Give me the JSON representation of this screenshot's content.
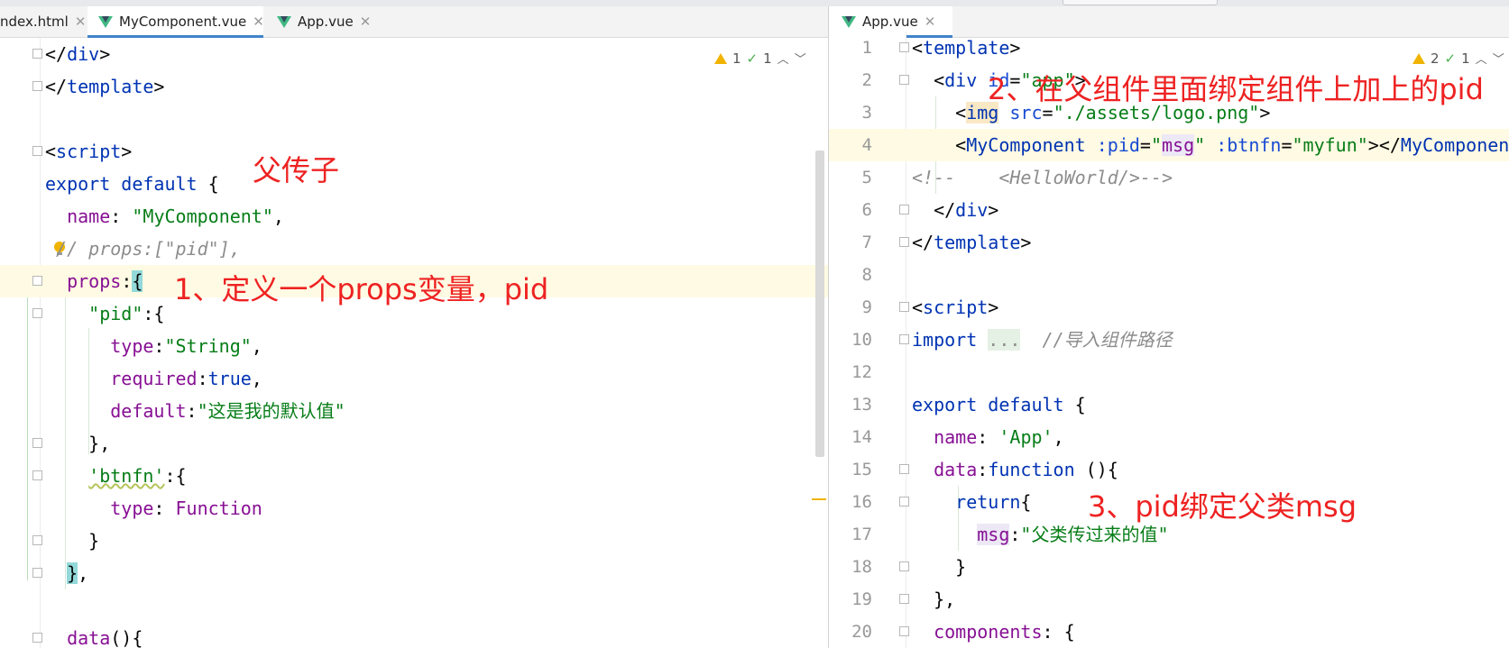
{
  "left_tabs": [
    {
      "label": "ndex.html"
    },
    {
      "label": "MyComponent.vue"
    },
    {
      "label": "App.vue"
    }
  ],
  "right_tabs": [
    {
      "label": "App.vue"
    }
  ],
  "left_indicators": {
    "warnings": "1",
    "checks": "1"
  },
  "right_indicators": {
    "warnings": "2",
    "checks": "1"
  },
  "left_code": {
    "l1": [
      "</",
      "div",
      ">"
    ],
    "l2": [
      "</",
      "template",
      ">"
    ],
    "l4": [
      "<",
      "script",
      ">"
    ],
    "l5": [
      "export default",
      " {"
    ],
    "l6": [
      "  ",
      "name",
      ": ",
      "\"MyComponent\"",
      ","
    ],
    "l7": [
      " // props:[\"pid\"],"
    ],
    "l8": [
      "  ",
      "props",
      ":",
      "{"
    ],
    "l9": [
      "    ",
      "\"pid\"",
      ":{"
    ],
    "l10": [
      "      ",
      "type",
      ":",
      "\"String\"",
      ","
    ],
    "l11": [
      "      ",
      "required",
      ":",
      "true",
      ","
    ],
    "l12": [
      "      ",
      "default",
      ":",
      "\"这是我的默认值\""
    ],
    "l13": [
      "    },"
    ],
    "l14": [
      "    ",
      "'btnfn'",
      ":{"
    ],
    "l15": [
      "      ",
      "type",
      ": ",
      "Function"
    ],
    "l16": [
      "    }"
    ],
    "l17": [
      "  ",
      "}",
      ","
    ],
    "l19": [
      "  ",
      "data",
      "(){"
    ]
  },
  "right_code": {
    "r1": {
      "num": "1",
      "parts": [
        "<",
        "template",
        ">"
      ]
    },
    "r2": {
      "num": "2",
      "parts": [
        "  <",
        "div",
        " ",
        "id",
        "=",
        "\"app\"",
        ">"
      ]
    },
    "r3": {
      "num": "3",
      "parts": [
        "    <",
        "img",
        " ",
        "src",
        "=",
        "\"./assets/logo.png\"",
        ">"
      ]
    },
    "r4": {
      "num": "4",
      "parts": [
        "    <",
        "MyComponent",
        " ",
        ":pid",
        "=",
        "\"",
        "msg",
        "\"",
        " ",
        ":btnfn",
        "=",
        "\"myfun\"",
        "></",
        "MyComponent",
        ">"
      ]
    },
    "r5": {
      "num": "5",
      "parts": [
        "<!--    <HelloWorld/>-->"
      ]
    },
    "r6": {
      "num": "6",
      "parts": [
        "  </",
        "div",
        ">"
      ]
    },
    "r7": {
      "num": "7",
      "parts": [
        "</",
        "template",
        ">"
      ]
    },
    "r8": {
      "num": "8",
      "parts": []
    },
    "r9": {
      "num": "9",
      "parts": [
        "<",
        "script",
        ">"
      ]
    },
    "r10": {
      "num": "10",
      "parts": [
        "import",
        " ",
        "...",
        "  ",
        "//导入组件路径"
      ]
    },
    "r12": {
      "num": "12",
      "parts": []
    },
    "r13": {
      "num": "13",
      "parts": [
        "export default",
        " {"
      ]
    },
    "r14": {
      "num": "14",
      "parts": [
        "  ",
        "name",
        ": ",
        "'App'",
        ","
      ]
    },
    "r15": {
      "num": "15",
      "parts": [
        "  ",
        "data",
        ":",
        "function",
        " (){"
      ]
    },
    "r16": {
      "num": "16",
      "parts": [
        "    ",
        "return",
        "{"
      ]
    },
    "r17": {
      "num": "17",
      "parts": [
        "      ",
        "msg",
        ":",
        "\"父类传过来的值\""
      ]
    },
    "r18": {
      "num": "18",
      "parts": [
        "    }"
      ]
    },
    "r19": {
      "num": "19",
      "parts": [
        "  },"
      ]
    },
    "r20": {
      "num": "20",
      "parts": [
        "  ",
        "components",
        ": {"
      ]
    }
  },
  "annotations": {
    "a1": "父传子",
    "a2": "1、定义一个props变量，pid",
    "a3": "2、在父组件里面绑定组件上加上的pid",
    "a4": "3、pid绑定父类msg"
  }
}
